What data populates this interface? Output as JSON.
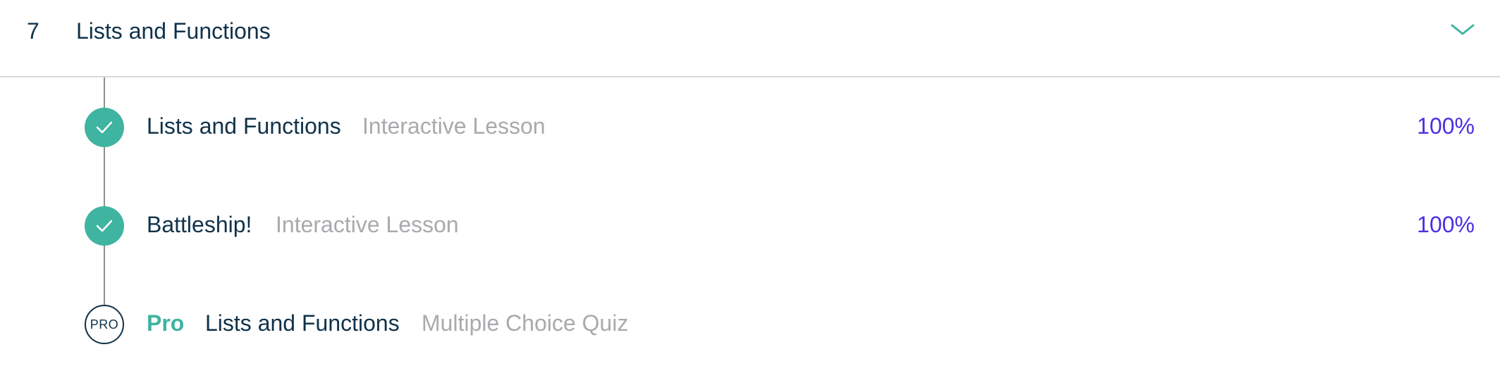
{
  "chapter": {
    "number": "7",
    "title": "Lists and Functions",
    "toggle_icon": "chevron-down-icon"
  },
  "colors": {
    "text": "#10324a",
    "muted": "#a8aaad",
    "accent_teal": "#3fb4a0",
    "percent_purple": "#4b2fe0",
    "divider": "#d6d8db"
  },
  "lessons": [
    {
      "title": "Lists and Functions",
      "type": "Interactive Lesson",
      "progress": "100%",
      "status_icon": "check-icon"
    },
    {
      "title": "Battleship!",
      "type": "Interactive Lesson",
      "progress": "100%",
      "status_icon": "check-icon"
    },
    {
      "pro_label": "Pro",
      "badge": "PRO",
      "title": "Lists and Functions",
      "type": "Multiple Choice Quiz",
      "status_icon": "pro-badge-icon"
    }
  ]
}
